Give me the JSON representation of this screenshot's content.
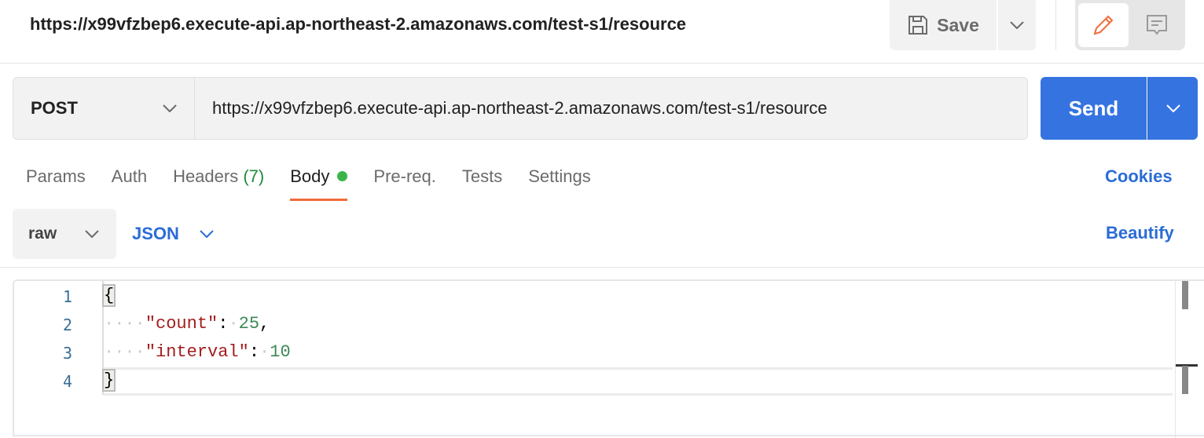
{
  "header": {
    "title": "https://x99vfzbep6.execute-api.ap-northeast-2.amazonaws.com/test-s1/resource",
    "save_label": "Save"
  },
  "request": {
    "method": "POST",
    "url": "https://x99vfzbep6.execute-api.ap-northeast-2.amazonaws.com/test-s1/resource",
    "send_label": "Send"
  },
  "tabs": [
    {
      "label": "Params"
    },
    {
      "label": "Auth"
    },
    {
      "label": "Headers",
      "count": "(7)"
    },
    {
      "label": "Body",
      "active": true
    },
    {
      "label": "Pre-req."
    },
    {
      "label": "Tests"
    },
    {
      "label": "Settings"
    }
  ],
  "cookies_label": "Cookies",
  "body": {
    "mode": "raw",
    "language": "JSON",
    "beautify_label": "Beautify"
  },
  "editor": {
    "line_numbers": [
      "1",
      "2",
      "3",
      "4"
    ],
    "lines": {
      "l1": "{",
      "l2_key": "\"count\"",
      "l2_val": "25",
      "l3_key": "\"interval\"",
      "l3_val": "10",
      "l4": "}"
    }
  },
  "colors": {
    "accent": "#3574e0",
    "active_tab": "#f26b3a",
    "body_dot": "#3bb54a",
    "json_key": "#a31d1d",
    "json_number": "#3c8a55"
  }
}
